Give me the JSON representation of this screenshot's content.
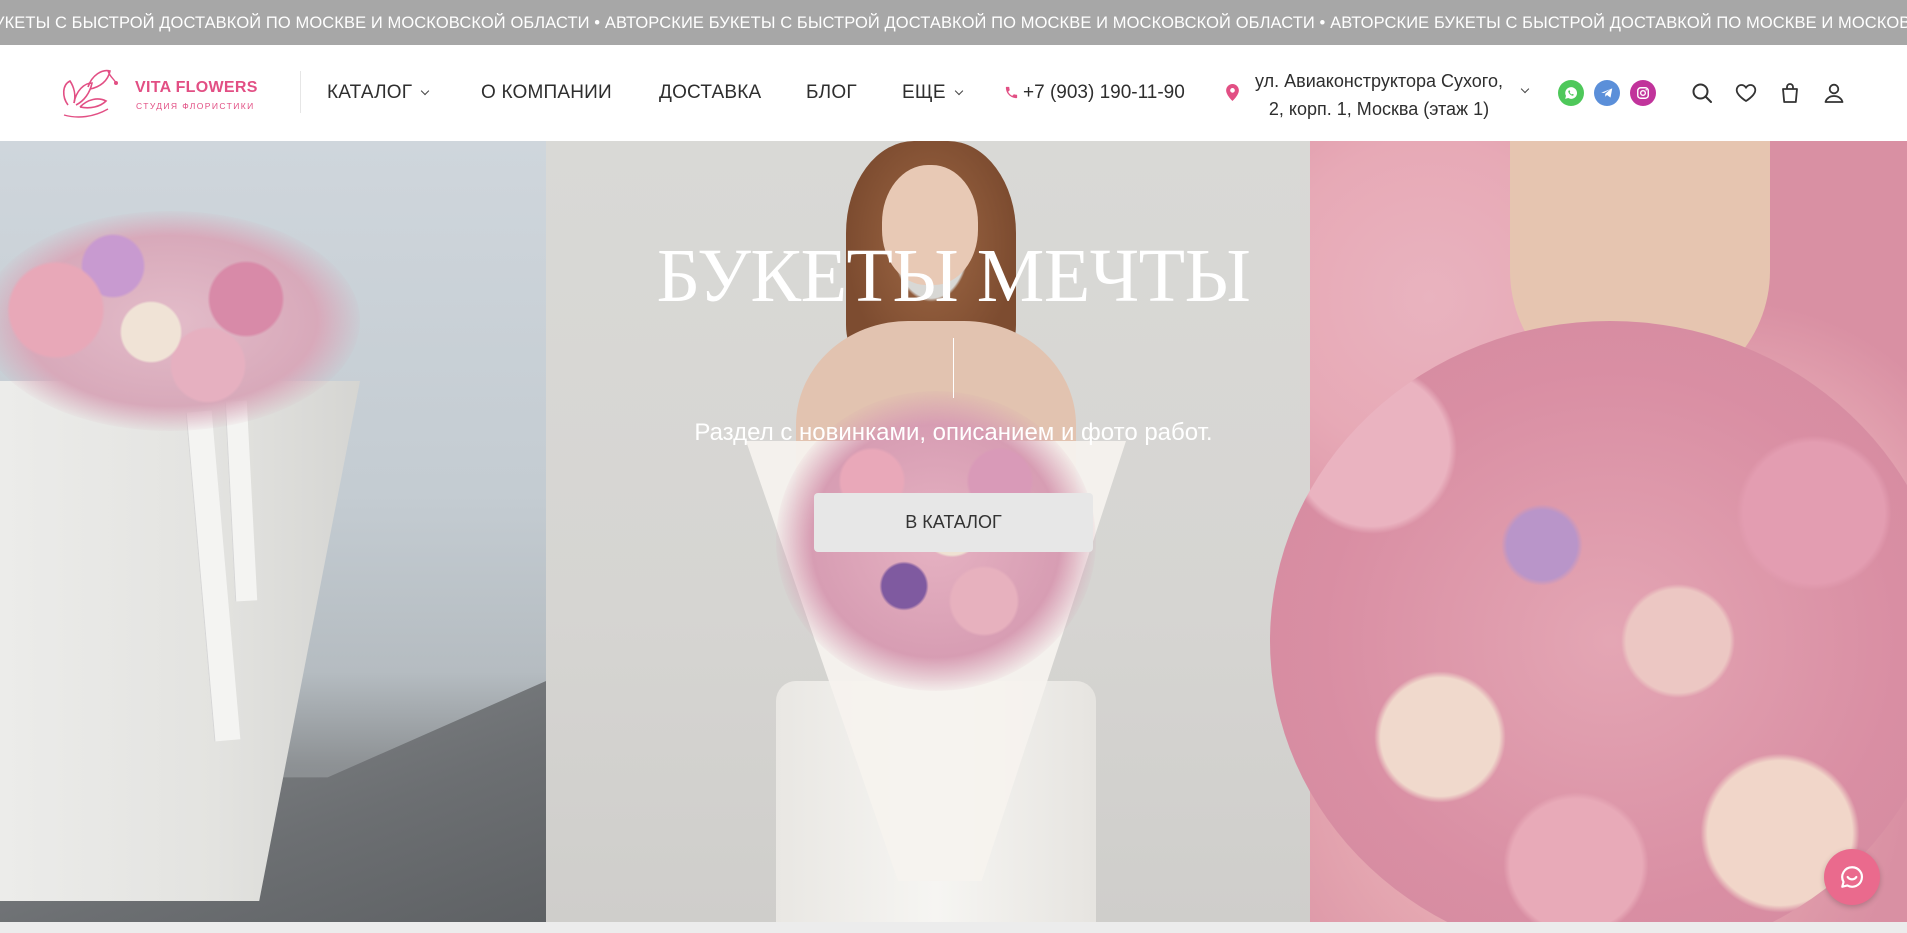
{
  "ticker": {
    "text": "УКЕТЫ С БЫСТРОЙ ДОСТАВКОЙ ПО МОСКВЕ И МОСКОВСКОЙ ОБЛАСТИ • АВТОРСКИЕ БУКЕТЫ С БЫСТРОЙ ДОСТАВКОЙ ПО МОСКВЕ И МОСКОВСКОЙ ОБЛАСТИ • АВТОРСКИЕ БУКЕТЫ С БЫСТРОЙ ДОСТАВКОЙ ПО МОСКВЕ И МОСКОВСКОЙ ОБЛАСТИ • АВТОРСКИЕ БУКЕ"
  },
  "header": {
    "logo_name": "VITA FLOWERS",
    "logo_subtitle": "СТУДИЯ ФЛОРИСТИКИ",
    "nav": {
      "catalog": "КАТАЛОГ",
      "about": "О КОМПАНИИ",
      "delivery": "ДОСТАВКА",
      "blog": "БЛОГ",
      "more": "ЕЩЕ"
    },
    "phone": "+7 (903) 190-11-90",
    "address_line1": "ул. Авиаконструктора Сухого,",
    "address_line2": "2, корп. 1, Москва (этаж 1)",
    "social": [
      "whatsapp-icon",
      "telegram-icon",
      "instagram-icon"
    ],
    "icons": [
      "search-icon",
      "heart-icon",
      "cart-icon",
      "user-icon"
    ]
  },
  "hero": {
    "title": "БУКЕТЫ МЕЧТЫ",
    "subtitle": "Раздел с новинками, описанием и фото работ.",
    "button": "В КАТАЛОГ"
  },
  "colors": {
    "brand_pink": "#e24f84",
    "whatsapp": "#4ec85a",
    "telegram": "#5b8fd9",
    "instagram": "#c1339b",
    "chat": "#ea6a8d",
    "ticker_bg": "#a7a7a7"
  }
}
